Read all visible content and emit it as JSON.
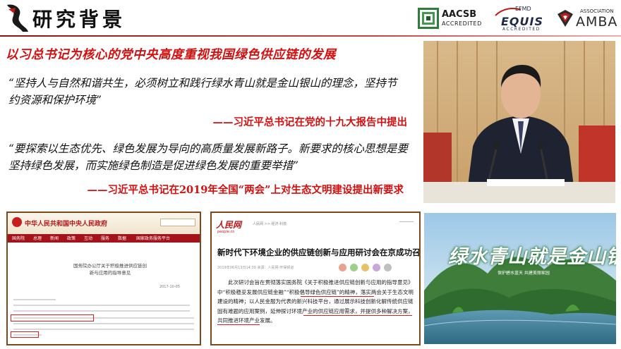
{
  "header": {
    "title": "研究背景",
    "logos": {
      "aacsb": {
        "name": "AACSB",
        "sub": "ACCREDITED"
      },
      "equis": {
        "top": "EFMD",
        "name": "EQUIS",
        "sub": "ACCREDITED"
      },
      "amba": {
        "top": "ASSOCIATION",
        "name": "AMBA"
      }
    }
  },
  "headline": "以习总书记为核心的党中央高度重视我国绿色供应链的发展",
  "quotes": [
    {
      "text": "“坚持人与自然和谐共生，必须树立和践行绿水青山就是金山银山的理念，坚持节约资源和保护环境”",
      "source": "——习近平总书记在党的十九大报告中提出"
    },
    {
      "text": "“要探索以生态优先、绿色发展为导向的高质量发展新路子。新要求的核心思想是要坚持绿色发展，而实施绿色制造是促进绿色发展的重要举措”",
      "source": "——习近平总书记在2019年全国“两会”上对生态文明建设提出新要求"
    }
  ],
  "gov_screenshot": {
    "site_name": "中华人民共和国中央人民政府",
    "nav": [
      "国务院",
      "总理",
      "新闻",
      "政策",
      "互动",
      "服务",
      "数据",
      "国家政务服务平台"
    ],
    "doc_title": "国务院办公厅关于积极推进供应链创新与应用的指导意见",
    "date": "2017-10-05"
  },
  "news_screenshot": {
    "logo": "人民网",
    "logo_sub": "people.cn",
    "crumb": "人民网 >> 经济·科技",
    "title": "新时代下环境企业的供应链创新与应用研讨会在京成功召开",
    "meta": "2019年06月13日14:39  来源：人民网-环保频道",
    "body": "此次研讨会旨在贯彻落实国务院《关于积极推进供应链创新与应用的指导意见》中“积极稳妥发展供应链金融”“积极倡导绿色供应链”的精神，落实两会关于生态文明建设的精神；以人民金服为代表的新兴科技平台，通过展示科技创新化解传统供应链固有难题的应用案例，延伸探讨环境产业的供应链应用需求，并提供多种解决方案，共同推进环境产业发展。"
  },
  "landscape": {
    "slogan": "绿水青山就是金山银山",
    "sub": "保护碧水蓝天 共建美丽家园"
  },
  "colors": {
    "accent_red": "#d40f0f",
    "frame_brown": "#7a4a1c",
    "gov_red": "#a4121a"
  }
}
